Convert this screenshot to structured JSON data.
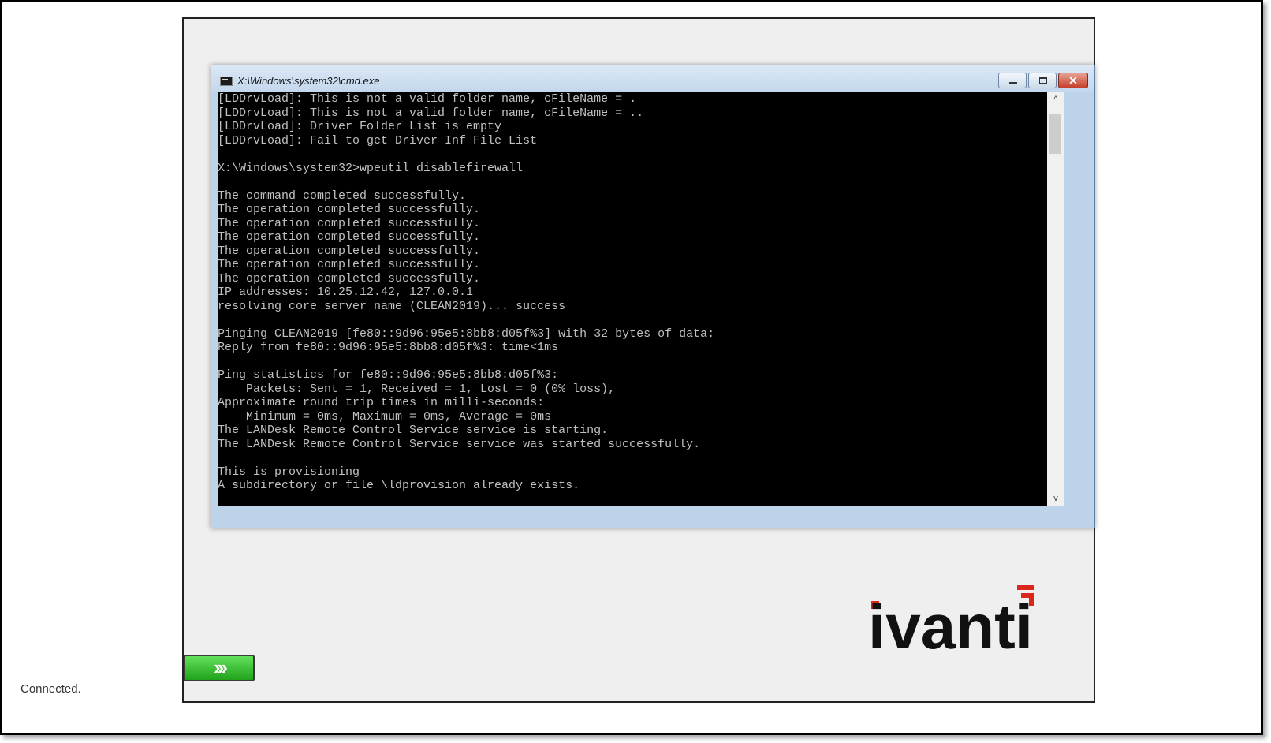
{
  "window": {
    "title": "X:\\Windows\\system32\\cmd.exe",
    "close_glyph": "✕"
  },
  "console": {
    "lines": [
      "[LDDrvLoad]: This is not a valid folder name, cFileName = .",
      "[LDDrvLoad]: This is not a valid folder name, cFileName = ..",
      "[LDDrvLoad]: Driver Folder List is empty",
      "[LDDrvLoad]: Fail to get Driver Inf File List",
      "",
      "X:\\Windows\\system32>wpeutil disablefirewall",
      "",
      "The command completed successfully.",
      "The operation completed successfully.",
      "The operation completed successfully.",
      "The operation completed successfully.",
      "The operation completed successfully.",
      "The operation completed successfully.",
      "The operation completed successfully.",
      "IP addresses: 10.25.12.42, 127.0.0.1",
      "resolving core server name (CLEAN2019)... success",
      "",
      "Pinging CLEAN2019 [fe80::9d96:95e5:8bb8:d05f%3] with 32 bytes of data:",
      "Reply from fe80::9d96:95e5:8bb8:d05f%3: time<1ms",
      "",
      "Ping statistics for fe80::9d96:95e5:8bb8:d05f%3:",
      "    Packets: Sent = 1, Received = 1, Lost = 0 (0% loss),",
      "Approximate round trip times in milli-seconds:",
      "    Minimum = 0ms, Maximum = 0ms, Average = 0ms",
      "The LANDesk Remote Control Service service is starting.",
      "The LANDesk Remote Control Service service was started successfully.",
      "",
      "This is provisioning",
      "A subdirectory or file \\ldprovision already exists."
    ]
  },
  "scrollbar": {
    "up_glyph": "^",
    "down_glyph": "v"
  },
  "brand": {
    "name": "ivanti",
    "text_color": "#111111",
    "accent_color": "#da291c"
  },
  "next_button": {
    "glyph": "›››",
    "color": "#22a81c"
  },
  "status": {
    "text": "Connected."
  }
}
